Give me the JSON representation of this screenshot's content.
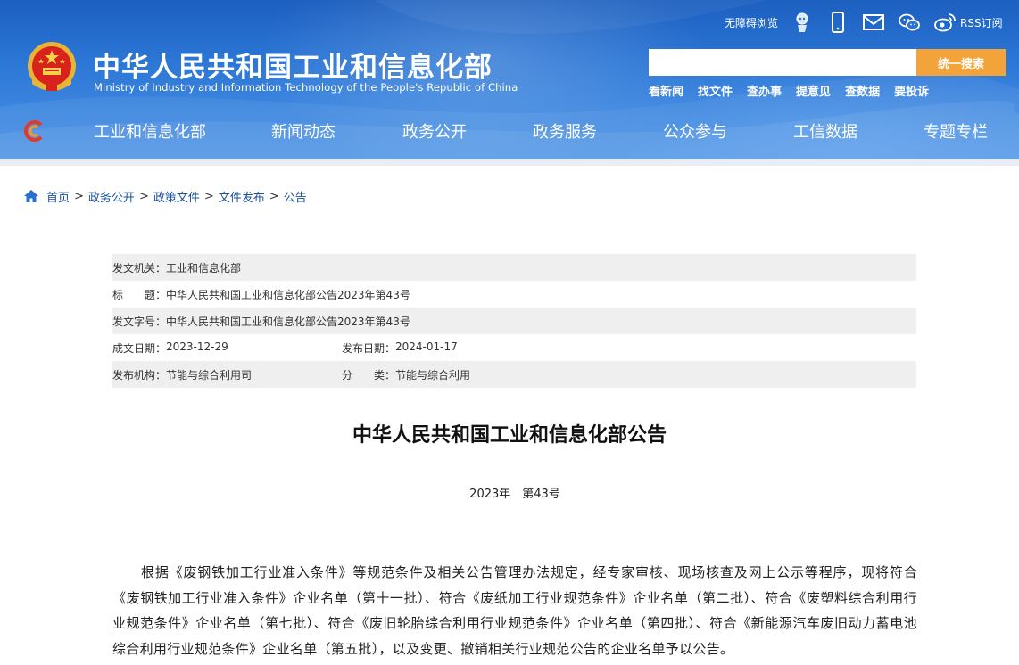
{
  "header": {
    "title": "中华人民共和国工业和信息化部",
    "subtitle": "Ministry of Industry and Information Technology of the People's Republic of China",
    "accessibility_label": "无障碍浏览",
    "rss_label": "RSS订阅",
    "icons": [
      "accessibility-robot-icon",
      "mobile-phone-icon",
      "mail-icon",
      "wechat-icon",
      "weibo-icon"
    ],
    "search": {
      "placeholder": "",
      "button_label": "统一搜索"
    },
    "quick_links": [
      "看新闻",
      "找文件",
      "查办事",
      "提意见",
      "查数据",
      "要投诉"
    ]
  },
  "nav": {
    "items": [
      "工业和信息化部",
      "新闻动态",
      "政务公开",
      "政务服务",
      "公众参与",
      "工信数据",
      "专题专栏"
    ]
  },
  "breadcrumb": [
    "首页",
    "政务公开",
    "政策文件",
    "文件发布",
    "公告"
  ],
  "meta": {
    "issuer_label": "发文机关：",
    "issuer": "工业和信息化部",
    "title_label": "标　　题：",
    "title": "中华人民共和国工业和信息化部公告2023年第43号",
    "doc_no_label": "发文字号：",
    "doc_no": "中华人民共和国工业和信息化部公告2023年第43号",
    "written_date_label": "成文日期：",
    "written_date": "2023-12-29",
    "publish_date_label": "发布日期：",
    "publish_date": "2024-01-17",
    "publisher_label": "发布机构：",
    "publisher": "节能与综合利用司",
    "category_label": "分　　类：",
    "category": "节能与综合利用"
  },
  "article": {
    "title": "中华人民共和国工业和信息化部公告",
    "number": "2023年　第43号",
    "paragraph1": "根据《废钢铁加工行业准入条件》等规范条件及相关公告管理办法规定，经专家审核、现场核查及网上公示等程序，现将符合《废钢铁加工行业准入条件》企业名单（第十一批）、符合《废纸加工行业规范条件》企业名单（第二批）、符合《废塑料综合利用行业规范条件》企业名单（第七批）、符合《废旧轮胎综合利用行业规范条件》企业名单（第四批）、符合《新能源汽车废旧动力蓄电池综合利用行业规范条件》企业名单（第五批），以及变更、撤销相关行业规范公告的企业名单予以公告。"
  },
  "colors": {
    "header_blue": "#2a74d4",
    "search_button": "#f2a33a",
    "link_blue": "#1a4f9c",
    "meta_shade": "#efefef"
  }
}
